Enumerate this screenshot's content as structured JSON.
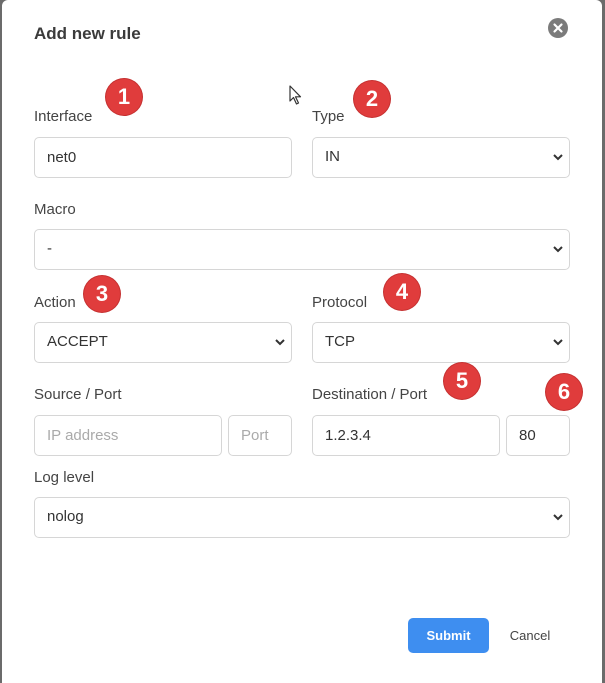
{
  "dialog": {
    "title": "Add new rule"
  },
  "form": {
    "interface": {
      "label": "Interface",
      "value": "net0"
    },
    "type": {
      "label": "Type",
      "value": "IN"
    },
    "macro": {
      "label": "Macro",
      "value": "-"
    },
    "action": {
      "label": "Action",
      "value": "ACCEPT"
    },
    "protocol": {
      "label": "Protocol",
      "value": "TCP"
    },
    "source": {
      "label": "Source / Port",
      "ip_placeholder": "IP address",
      "port_placeholder": "Port"
    },
    "destination": {
      "label": "Destination / Port",
      "ip_value": "1.2.3.4",
      "port_value": "80"
    },
    "log_level": {
      "label": "Log level",
      "value": "nolog"
    }
  },
  "buttons": {
    "submit": "Submit",
    "cancel": "Cancel"
  },
  "badges": [
    "1",
    "2",
    "3",
    "4",
    "5",
    "6"
  ],
  "colors": {
    "accent": "#3e8ef0",
    "badge": "#e03c3c"
  }
}
